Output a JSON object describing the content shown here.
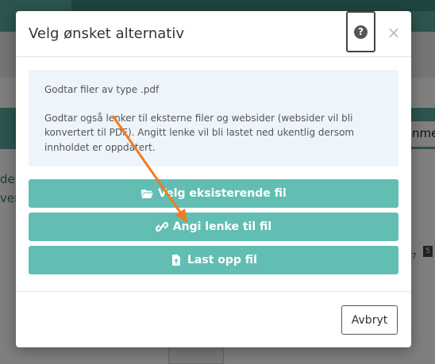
{
  "background": {
    "side_text_1": "del",
    "side_text_2": "ver",
    "input_text": "nme",
    "counter_text": "/ 7",
    "badge_count": "5"
  },
  "modal": {
    "title": "Velg ønsket alternativ",
    "help_icon": "question-circle-icon",
    "help_glyph": "?",
    "close_glyph": "×",
    "info": {
      "line1": "Godtar filer av type .pdf",
      "line2": "Godtar også lenker til eksterne filer og websider (websider vil bli konvertert til PDF). Angitt lenke vil bli lastet ned ukentlig dersom innholdet er oppdatert."
    },
    "buttons": {
      "existing_label": "Velg eksisterende fil",
      "link_label": "Angi lenke til fil",
      "upload_label": "Last opp fil"
    },
    "cancel_label": "Avbryt"
  },
  "colors": {
    "accent": "#62bdb2",
    "annotation_arrow": "#f47a20",
    "info_bg": "#eef4fb"
  }
}
